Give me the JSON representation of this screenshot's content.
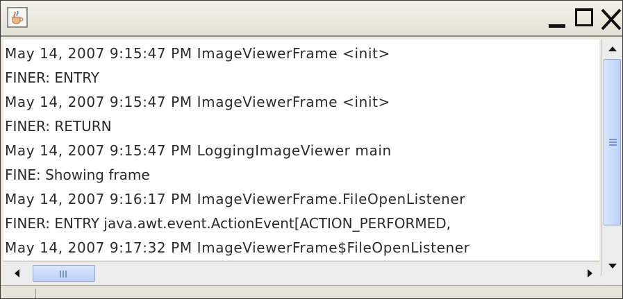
{
  "window": {
    "icon": "java-coffee-icon",
    "controls": {
      "minimize": "minimize-icon",
      "maximize": "maximize-icon",
      "close": "close-icon"
    }
  },
  "log": {
    "lines": [
      "May 14, 2007 9:15:47 PM ImageViewerFrame <init>",
      "FINER: ENTRY",
      "May 14, 2007 9:15:47 PM ImageViewerFrame <init>",
      "FINER: RETURN",
      "May 14, 2007 9:15:47 PM LoggingImageViewer main",
      "FINE: Showing frame",
      "May 14, 2007 9:16:17 PM ImageViewerFrame.FileOpenListener",
      "FINER: ENTRY java.awt.event.ActionEvent[ACTION_PERFORMED,",
      "May 14, 2007 9:17:32 PM ImageViewerFrame$FileOpenListener"
    ]
  },
  "scrollbars": {
    "vertical": {
      "up_icon": "arrow-up-icon",
      "down_icon": "arrow-down-icon"
    },
    "horizontal": {
      "left_icon": "arrow-left-icon",
      "right_icon": "arrow-right-icon"
    }
  },
  "colors": {
    "thumb": "#c7d8f6",
    "text": "#2a2a2a"
  }
}
